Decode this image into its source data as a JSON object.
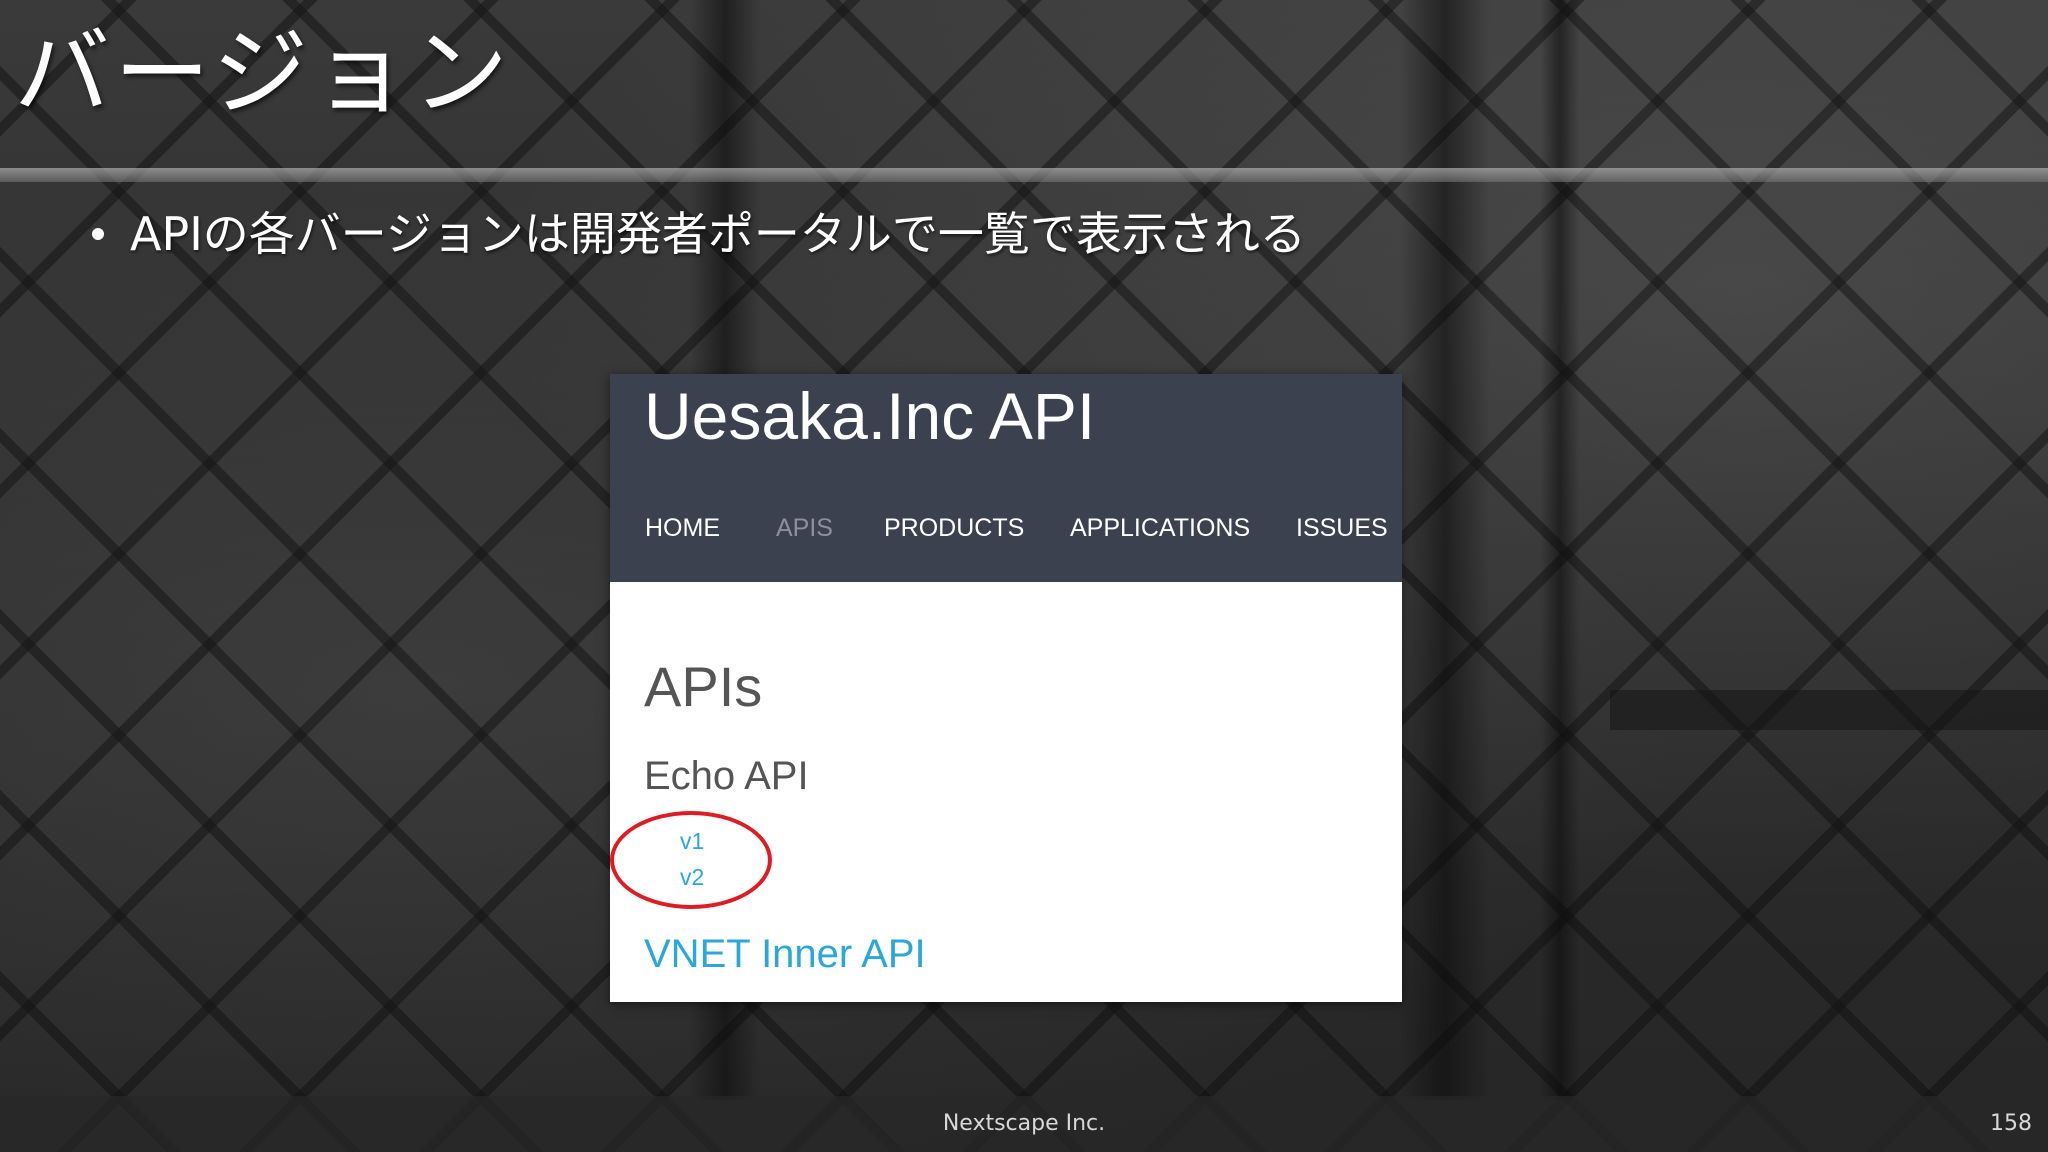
{
  "slide": {
    "title": "バージョン",
    "bullet": "APIの各バージョンは開発者ポータルで一覧で表示される"
  },
  "portal": {
    "site_title": "Uesaka.Inc API",
    "nav": {
      "home": "HOME",
      "apis": "APIS",
      "products": "PRODUCTS",
      "applications": "APPLICATIONS",
      "issues": "ISSUES"
    },
    "active_nav": "APIS",
    "heading": "APIs",
    "apis": [
      {
        "name": "Echo API",
        "versions": [
          "v1",
          "v2"
        ]
      },
      {
        "name": "VNET Inner API"
      }
    ],
    "colors": {
      "header_bg": "#3c4150",
      "link": "#29a8d9",
      "highlight": "#e01c22"
    }
  },
  "footer": {
    "company": "Nextscape Inc.",
    "page_number": "158"
  }
}
